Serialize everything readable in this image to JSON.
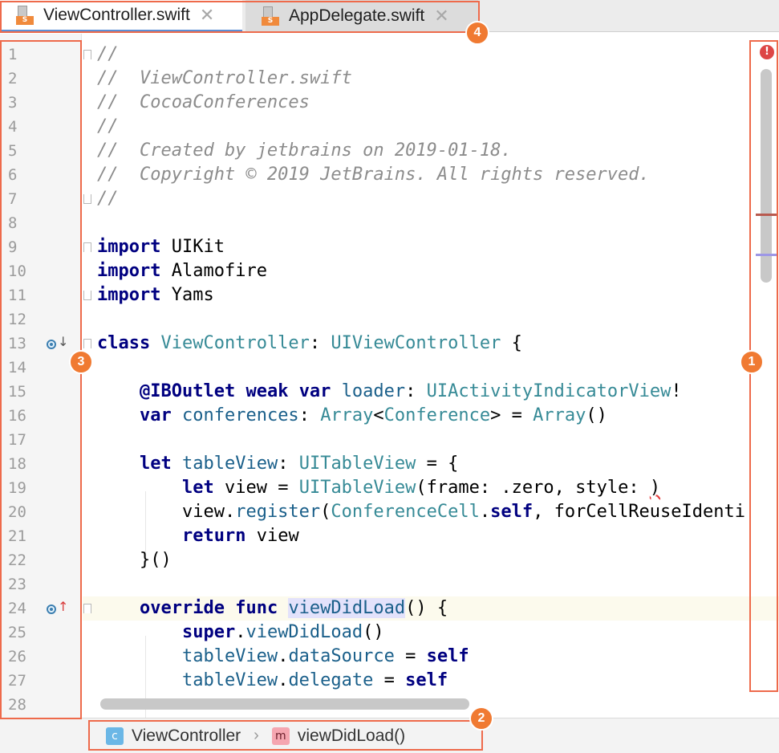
{
  "tabs": [
    {
      "label": "ViewController.swift",
      "active": true
    },
    {
      "label": "AppDelegate.swift",
      "active": false
    }
  ],
  "tab_close_glyph": "✕",
  "file_badge": "S",
  "line_numbers": [
    "1",
    "2",
    "3",
    "4",
    "5",
    "6",
    "7",
    "8",
    "9",
    "10",
    "11",
    "12",
    "13",
    "14",
    "15",
    "16",
    "17",
    "18",
    "19",
    "20",
    "21",
    "22",
    "23",
    "24",
    "25",
    "26",
    "27",
    "28"
  ],
  "code": {
    "l1": "//",
    "l2": "//  ViewController.swift",
    "l3": "//  CocoaConferences",
    "l4": "//",
    "l5": "//  Created by jetbrains on 2019-01-18.",
    "l6": "//  Copyright © 2019 JetBrains. All rights reserved.",
    "l7": "//",
    "import": "import",
    "uikit": "UIKit",
    "alamofire": "Alamofire",
    "yams": "Yams",
    "class_kw": "class",
    "class_name": "ViewController",
    "superclass": "UIViewController",
    "iboutlet": "@IBOutlet",
    "weak": "weak",
    "var": "var",
    "loader": "loader",
    "activity_type": "UIActivityIndicatorView",
    "conferences": "conferences",
    "array": "Array",
    "conference": "Conference",
    "let": "let",
    "tableview": "tableView",
    "tableview_type": "UITableView",
    "view": "view",
    "frame_arg": "frame: .zero, style: ",
    "register": "register",
    "conference_cell": "ConferenceCell",
    "self": "self",
    "reuse": "forCellReuseIdenti",
    "return": "return",
    "override": "override",
    "func": "func",
    "viewdidload": "viewDidLoad",
    "super": "super",
    "datasource": "dataSource",
    "delegate": "delegate"
  },
  "breadcrumb": {
    "class_icon": "c",
    "class_name": "ViewController",
    "separator": "›",
    "method_icon": "m",
    "method_name": "viewDidLoad()"
  },
  "error_icon": "!",
  "callouts": [
    "1",
    "2",
    "3",
    "4"
  ],
  "colors": {
    "accent": "#f07a32",
    "callout_border": "#ee6a4b",
    "keyword": "#000080",
    "type": "#368a96",
    "comment": "#8c8c8c",
    "error_mark": "#b85a4f",
    "info_mark": "#9d97e6"
  }
}
